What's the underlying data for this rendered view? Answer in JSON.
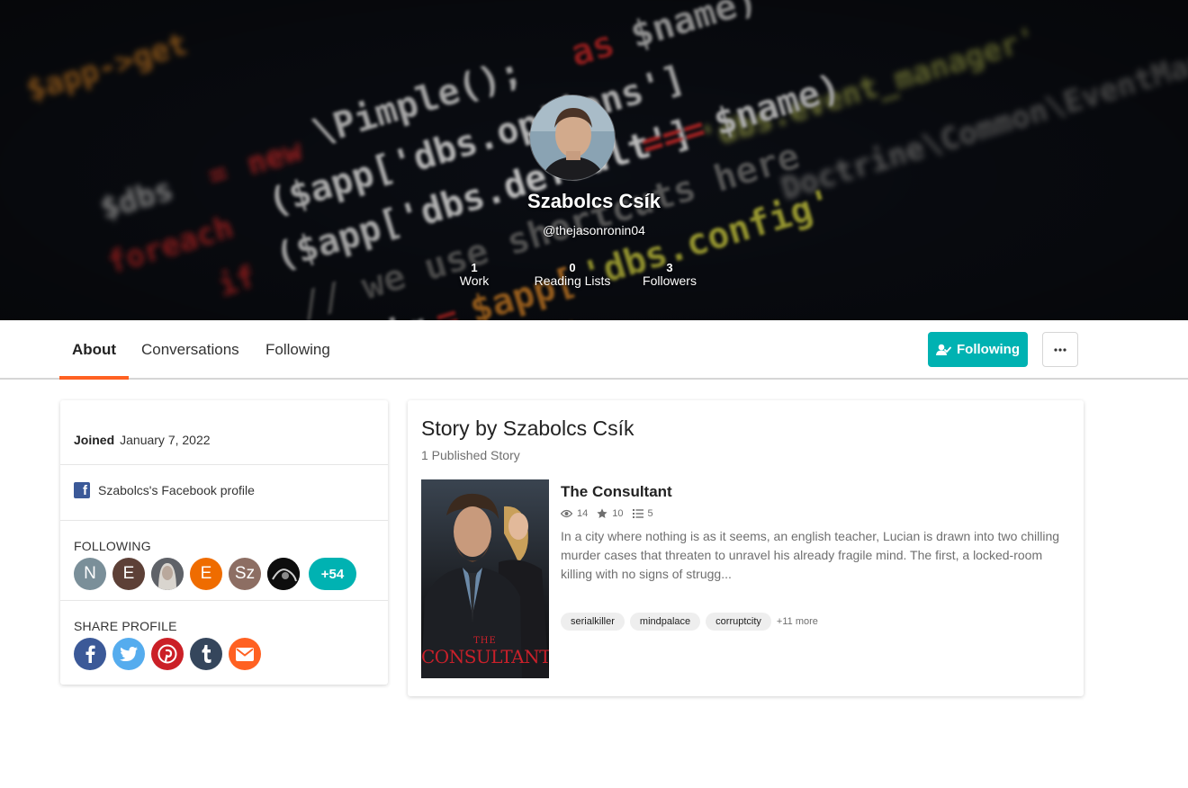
{
  "profile": {
    "display_name": "Szabolcs Csík",
    "username": "@thejasonronin04",
    "stats": [
      {
        "value": "1",
        "label": "Work"
      },
      {
        "value": "0",
        "label": "Reading Lists"
      },
      {
        "value": "3",
        "label": "Followers"
      }
    ]
  },
  "tabs": [
    {
      "label": "About",
      "active": true
    },
    {
      "label": "Conversations",
      "active": false
    },
    {
      "label": "Following",
      "active": false
    }
  ],
  "actions": {
    "follow_label": "Following",
    "more_icon": "ellipsis-icon"
  },
  "about": {
    "joined_label": "Joined",
    "joined_date": "January 7, 2022",
    "facebook_link": "Szabolcs's Facebook profile",
    "following_title": "FOLLOWING",
    "following_avatars": [
      {
        "letter": "N",
        "color": "#7a8f99"
      },
      {
        "letter": "E",
        "color": "#5d4037"
      },
      {
        "letter": "",
        "color": "#9ea3a8"
      },
      {
        "letter": "E",
        "color": "#ef6c00"
      },
      {
        "letter": "Sz",
        "color": "#8d6e63"
      },
      {
        "letter": "",
        "color": "#111111"
      }
    ],
    "following_more": "+54",
    "share_title": "SHARE PROFILE",
    "share_icons": [
      {
        "name": "facebook-icon",
        "color": "#3b5998"
      },
      {
        "name": "twitter-icon",
        "color": "#55acee"
      },
      {
        "name": "pinterest-icon",
        "color": "#cb2027"
      },
      {
        "name": "tumblr-icon",
        "color": "#35465c"
      },
      {
        "name": "email-icon",
        "color": "#ff6122"
      }
    ]
  },
  "stories": {
    "heading": "Story by Szabolcs Csík",
    "count": "1 Published Story",
    "items": [
      {
        "title": "The Consultant",
        "cover_text": "THE CONSULTANT",
        "reads": "14",
        "votes": "10",
        "parts": "5",
        "description": "In a city where nothing is as it seems, an english teacher, Lucian is drawn into two chilling murder cases that threaten to unravel his already fragile mind. The first, a locked-room killing with no signs of strugg...",
        "tags": [
          "serialkiller",
          "mindpalace",
          "corruptcity"
        ],
        "more_tags": "+11 more"
      }
    ]
  },
  "colors": {
    "accent_teal": "#00b2b2",
    "accent_orange": "#ff6122"
  }
}
